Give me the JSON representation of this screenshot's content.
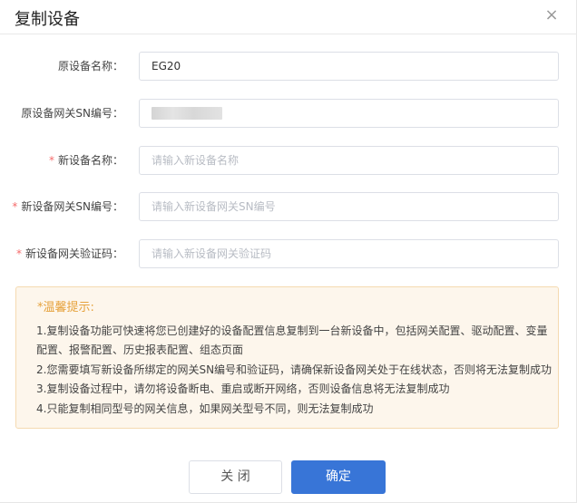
{
  "dialog": {
    "title": "复制设备",
    "close_icon": "close-icon",
    "close_glyph": "×"
  },
  "form": {
    "orig_name": {
      "label": "原设备名称：",
      "value": "EG20",
      "required": false
    },
    "orig_sn": {
      "label": "原设备网关SN编号：",
      "value": "",
      "required": false,
      "blurred": true
    },
    "new_name": {
      "label": "新设备名称：",
      "placeholder": "请输入新设备名称",
      "required": true
    },
    "new_sn": {
      "label": "新设备网关SN编号：",
      "placeholder": "请输入新设备网关SN编号",
      "required": true
    },
    "new_code": {
      "label": "新设备网关验证码：",
      "placeholder": "请输入新设备网关验证码",
      "required": true
    },
    "required_mark": "*"
  },
  "tips": {
    "title": "*温馨提示:",
    "lines": [
      "1.复制设备功能可快速将您已创建好的设备配置信息复制到一台新设备中，包括网关配置、驱动配置、变量",
      "配置、报警配置、历史报表配置、组态页面",
      "2.您需要填写新设备所绑定的网关SN编号和验证码，请确保新设备网关处于在线状态，否则将无法复制成功",
      "3.复制设备过程中，请勿将设备断电、重启或断开网络，否则设备信息将无法复制成功",
      "4.只能复制相同型号的网关信息，如果网关型号不同，则无法复制成功"
    ]
  },
  "footer": {
    "cancel_label": "关 闭",
    "ok_label": "确定"
  },
  "colors": {
    "primary": "#3875d7",
    "required": "#f56c6c",
    "tip_title": "#e6a23c",
    "tip_bg": "#fdf6ec"
  }
}
